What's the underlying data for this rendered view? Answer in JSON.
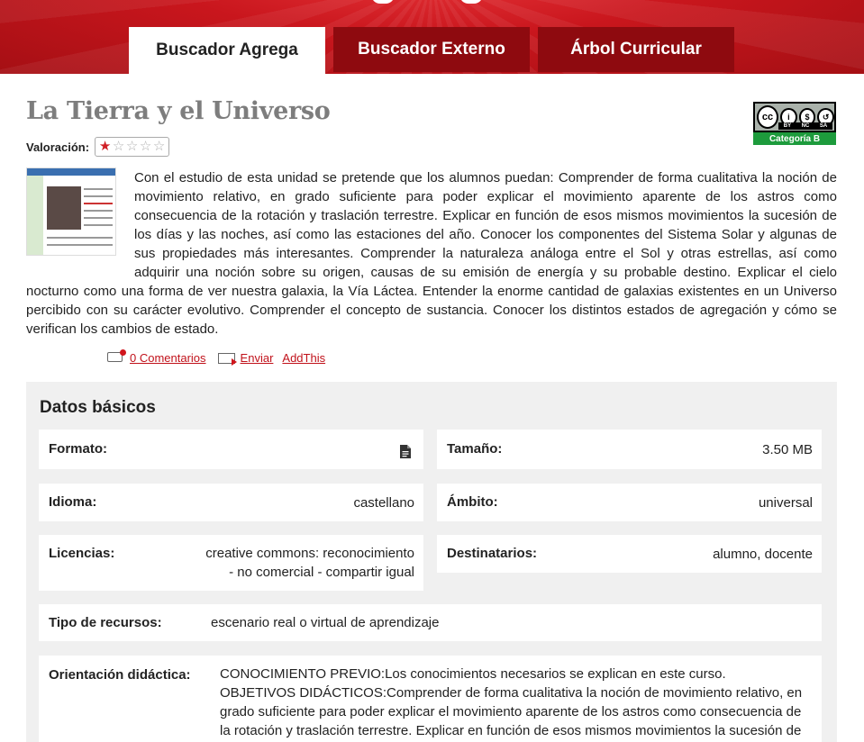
{
  "header": {
    "tabs": [
      {
        "label": "Buscador Agrega",
        "active": true
      },
      {
        "label": "Buscador Externo",
        "active": false
      },
      {
        "label": "Árbol Curricular",
        "active": false
      }
    ],
    "brand_color": "#c9161d"
  },
  "resource": {
    "title": "La Tierra y el Universo",
    "rating_label": "Valoración:",
    "rating": 1,
    "rating_max": 5,
    "license_badge": {
      "cc": "cc",
      "terms": [
        "BY",
        "NC",
        "SA"
      ],
      "category": "Categoría B"
    },
    "description": "Con el estudio de esta unidad se pretende que los alumnos puedan: Comprender de forma cualitativa la noción de movimiento relativo, en grado suficiente para poder explicar el movimiento aparente de los astros como consecuencia de la rotación y traslación terrestre. Explicar en función de esos mismos movimientos la sucesión de los días y las noches, así como las estaciones del año. Conocer los componentes del Sistema Solar y algunas de sus propiedades más interesantes. Comprender la naturaleza análoga entre el Sol y otras estrellas, así como adquirir una noción sobre su origen, causas de su emisión de energía y su probable destino. Explicar el cielo nocturno como una forma de ver nuestra galaxia, la Vía Láctea. Entender la enorme cantidad de galaxias existentes en un Universo percibido con su carácter evolutivo. Comprender el concepto de sustancia. Conocer los distintos estados de agregación y cómo se verifican los cambios de estado."
  },
  "actions": {
    "comments": "0 Comentarios",
    "send": "Enviar",
    "addthis": "AddThis"
  },
  "datos": {
    "title": "Datos básicos",
    "formato_label": "Formato:",
    "formato_icon": "document-icon",
    "tamano_label": "Tamaño:",
    "tamano_value": "3.50 MB",
    "idioma_label": "Idioma:",
    "idioma_value": "castellano",
    "ambito_label": "Ámbito:",
    "ambito_value": "universal",
    "licencias_label": "Licencias:",
    "licencias_value_1": "creative commons: reconocimiento",
    "licencias_value_2": "- no comercial - compartir igual",
    "destinatarios_label": "Destinatarios:",
    "destinatarios_value": "alumno, docente",
    "tipo_label": "Tipo de recursos:",
    "tipo_value": "escenario real o virtual de aprendizaje",
    "orientacion_label": "Orientación didáctica:",
    "orientacion_line_1": "CONOCIMIENTO PREVIO:Los conocimientos necesarios se explican en este curso.",
    "orientacion_line_2": "OBJETIVOS DIDÁCTICOS:Comprender de forma cualitativa la noción de movimiento relativo, en grado suficiente para poder explicar el movimiento aparente de los astros como consecuencia de la rotación y traslación terrestre. Explicar en función de esos mismos movimientos la sucesión de"
  }
}
